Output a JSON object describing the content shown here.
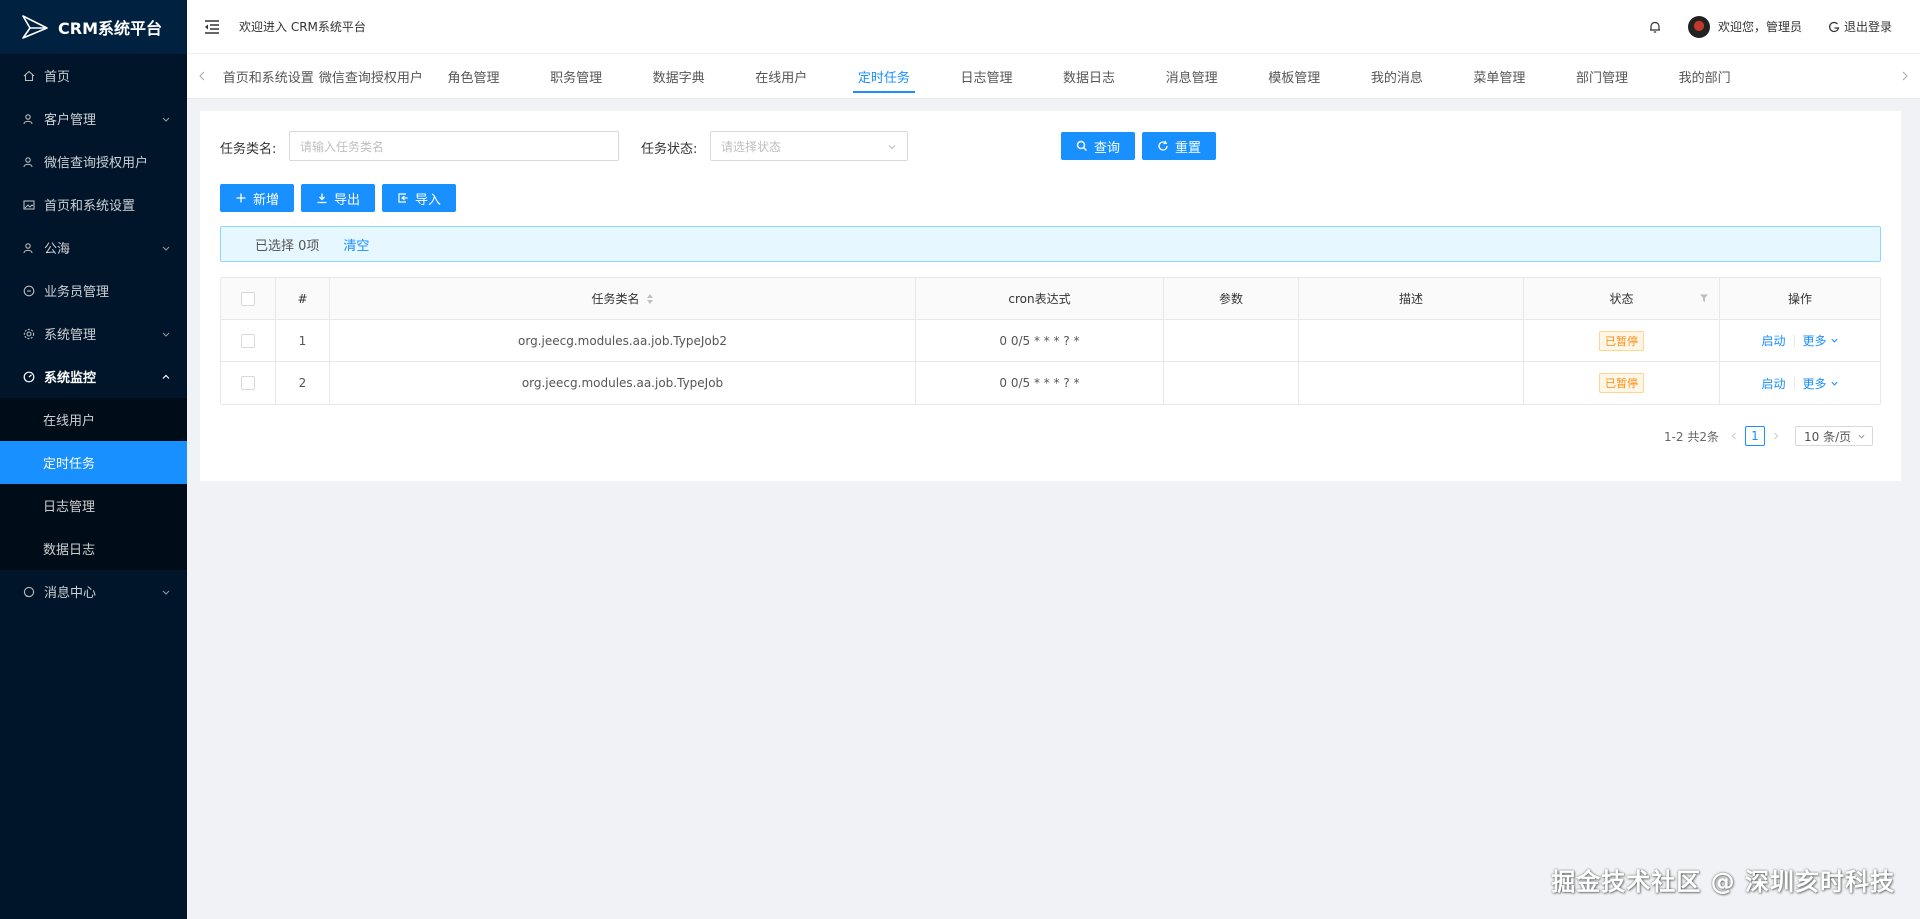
{
  "app": {
    "logo_text": "CRM系统平台"
  },
  "sidebar": {
    "items": [
      {
        "label": "首页",
        "icon": "home-icon"
      },
      {
        "label": "客户管理",
        "icon": "user-group-icon",
        "has_children": true
      },
      {
        "label": "微信查询授权用户",
        "icon": "user-group-icon"
      },
      {
        "label": "首页和系统设置",
        "icon": "picture-icon"
      },
      {
        "label": "公海",
        "icon": "user-group-icon",
        "has_children": true
      },
      {
        "label": "业务员管理",
        "icon": "clock-icon"
      },
      {
        "label": "系统管理",
        "icon": "gear-icon",
        "has_children": true
      },
      {
        "label": "系统监控",
        "icon": "dashboard-icon",
        "expanded": true,
        "children": [
          {
            "label": "在线用户"
          },
          {
            "label": "定时任务",
            "active": true
          },
          {
            "label": "日志管理"
          },
          {
            "label": "数据日志"
          }
        ]
      },
      {
        "label": "消息中心",
        "icon": "message-icon",
        "has_children": true
      }
    ]
  },
  "header": {
    "welcome": "欢迎进入 CRM系统平台",
    "user_greeting": "欢迎您，管理员",
    "logout": "退出登录"
  },
  "tabs": [
    {
      "label": "首页和系统设置"
    },
    {
      "label": "微信查询授权用户"
    },
    {
      "label": "角色管理"
    },
    {
      "label": "职务管理"
    },
    {
      "label": "数据字典"
    },
    {
      "label": "在线用户"
    },
    {
      "label": "定时任务",
      "active": true
    },
    {
      "label": "日志管理"
    },
    {
      "label": "数据日志"
    },
    {
      "label": "消息管理"
    },
    {
      "label": "模板管理"
    },
    {
      "label": "我的消息"
    },
    {
      "label": "菜单管理"
    },
    {
      "label": "部门管理"
    },
    {
      "label": "我的部门"
    }
  ],
  "search": {
    "name_label": "任务类名:",
    "name_placeholder": "请输入任务类名",
    "status_label": "任务状态:",
    "status_placeholder": "请选择状态",
    "query_button": "查询",
    "reset_button": "重置"
  },
  "toolbar": {
    "add": "新增",
    "export": "导出",
    "import": "导入"
  },
  "selection": {
    "text": "已选择 0项",
    "clear": "清空"
  },
  "table": {
    "columns": [
      "#",
      "任务类名",
      "cron表达式",
      "参数",
      "描述",
      "状态",
      "操作"
    ],
    "rows": [
      {
        "index": "1",
        "class_name": "org.jeecg.modules.aa.job.TypeJob2",
        "cron": "0 0/5 * * * ? *",
        "params": "",
        "desc": "",
        "status": "已暂停",
        "action": "启动",
        "more": "更多"
      },
      {
        "index": "2",
        "class_name": "org.jeecg.modules.aa.job.TypeJob",
        "cron": "0 0/5 * * * ? *",
        "params": "",
        "desc": "",
        "status": "已暂停",
        "action": "启动",
        "more": "更多"
      }
    ]
  },
  "pagination": {
    "total": "1-2 共2条",
    "current_page": "1",
    "page_size": "10 条/页"
  },
  "watermark": "掘金技术社区 @ 深圳亥时科技",
  "colors": {
    "primary": "#1890ff",
    "sidebar_bg": "#001529",
    "warning": "#fa8c16"
  }
}
